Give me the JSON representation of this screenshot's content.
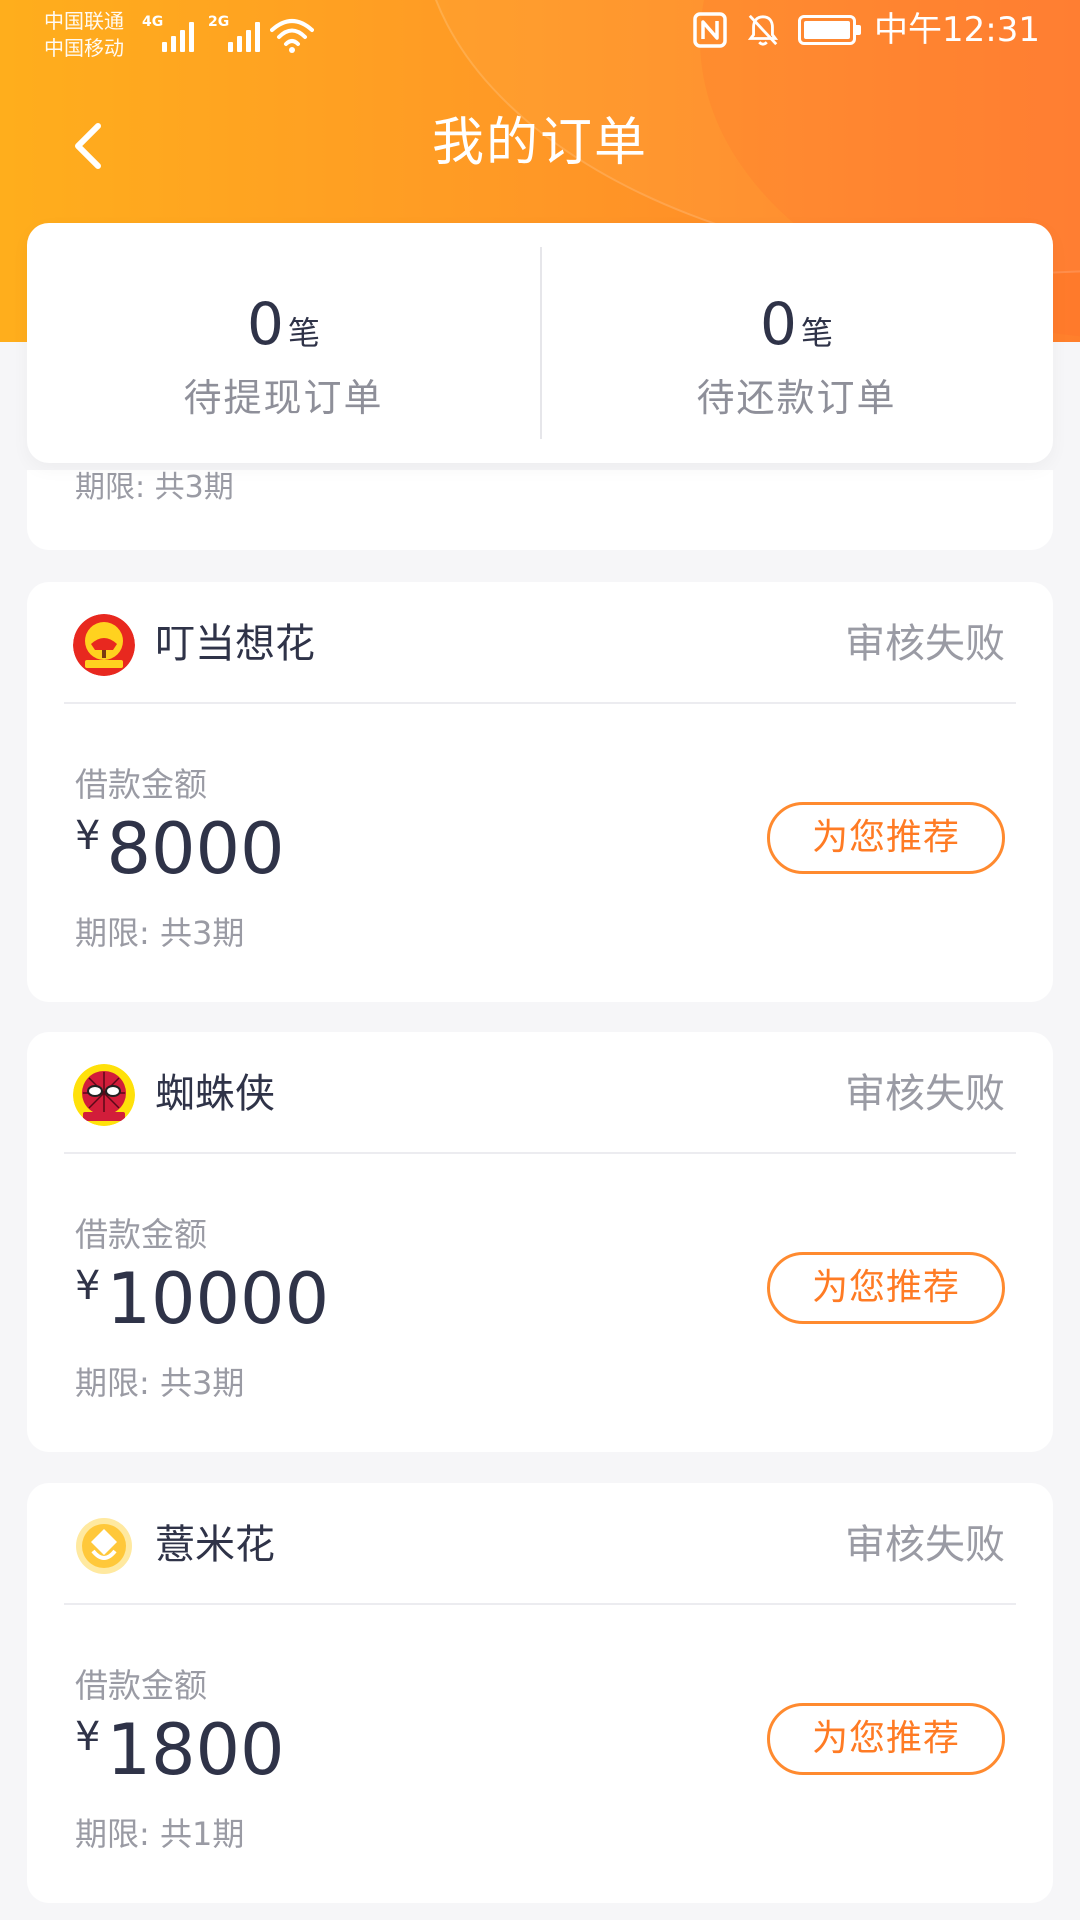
{
  "status_bar": {
    "carrier_1": "中国联通",
    "carrier_2": "中国移动",
    "sig1_tag": "4G",
    "sig2_tag": "2G",
    "time": "中午12:31"
  },
  "header": {
    "title": "我的订单"
  },
  "summary": {
    "pending_withdraw": {
      "count": "0",
      "unit": "笔",
      "label": "待提现订单"
    },
    "pending_repay": {
      "count": "0",
      "unit": "笔",
      "label": "待还款订单"
    }
  },
  "partial_card": {
    "term": "期限: 共3期"
  },
  "orders": [
    {
      "name": "叮当想花",
      "status": "审核失败",
      "amount_label": "借款金额",
      "currency": "¥",
      "amount": "8000",
      "term": "期限: 共3期",
      "button": "为您推荐"
    },
    {
      "name": "蜘蛛侠",
      "status": "审核失败",
      "amount_label": "借款金额",
      "currency": "¥",
      "amount": "10000",
      "term": "期限: 共3期",
      "button": "为您推荐"
    },
    {
      "name": "薏米花",
      "status": "审核失败",
      "amount_label": "借款金额",
      "currency": "¥",
      "amount": "1800",
      "term": "期限: 共1期",
      "button": "为您推荐"
    }
  ],
  "colors": {
    "header_start": "#ffae1c",
    "header_end": "#ff7f2c",
    "accent": "#ff7b24",
    "text_dark": "#2f3348",
    "text_gray": "#9a9ba4"
  }
}
